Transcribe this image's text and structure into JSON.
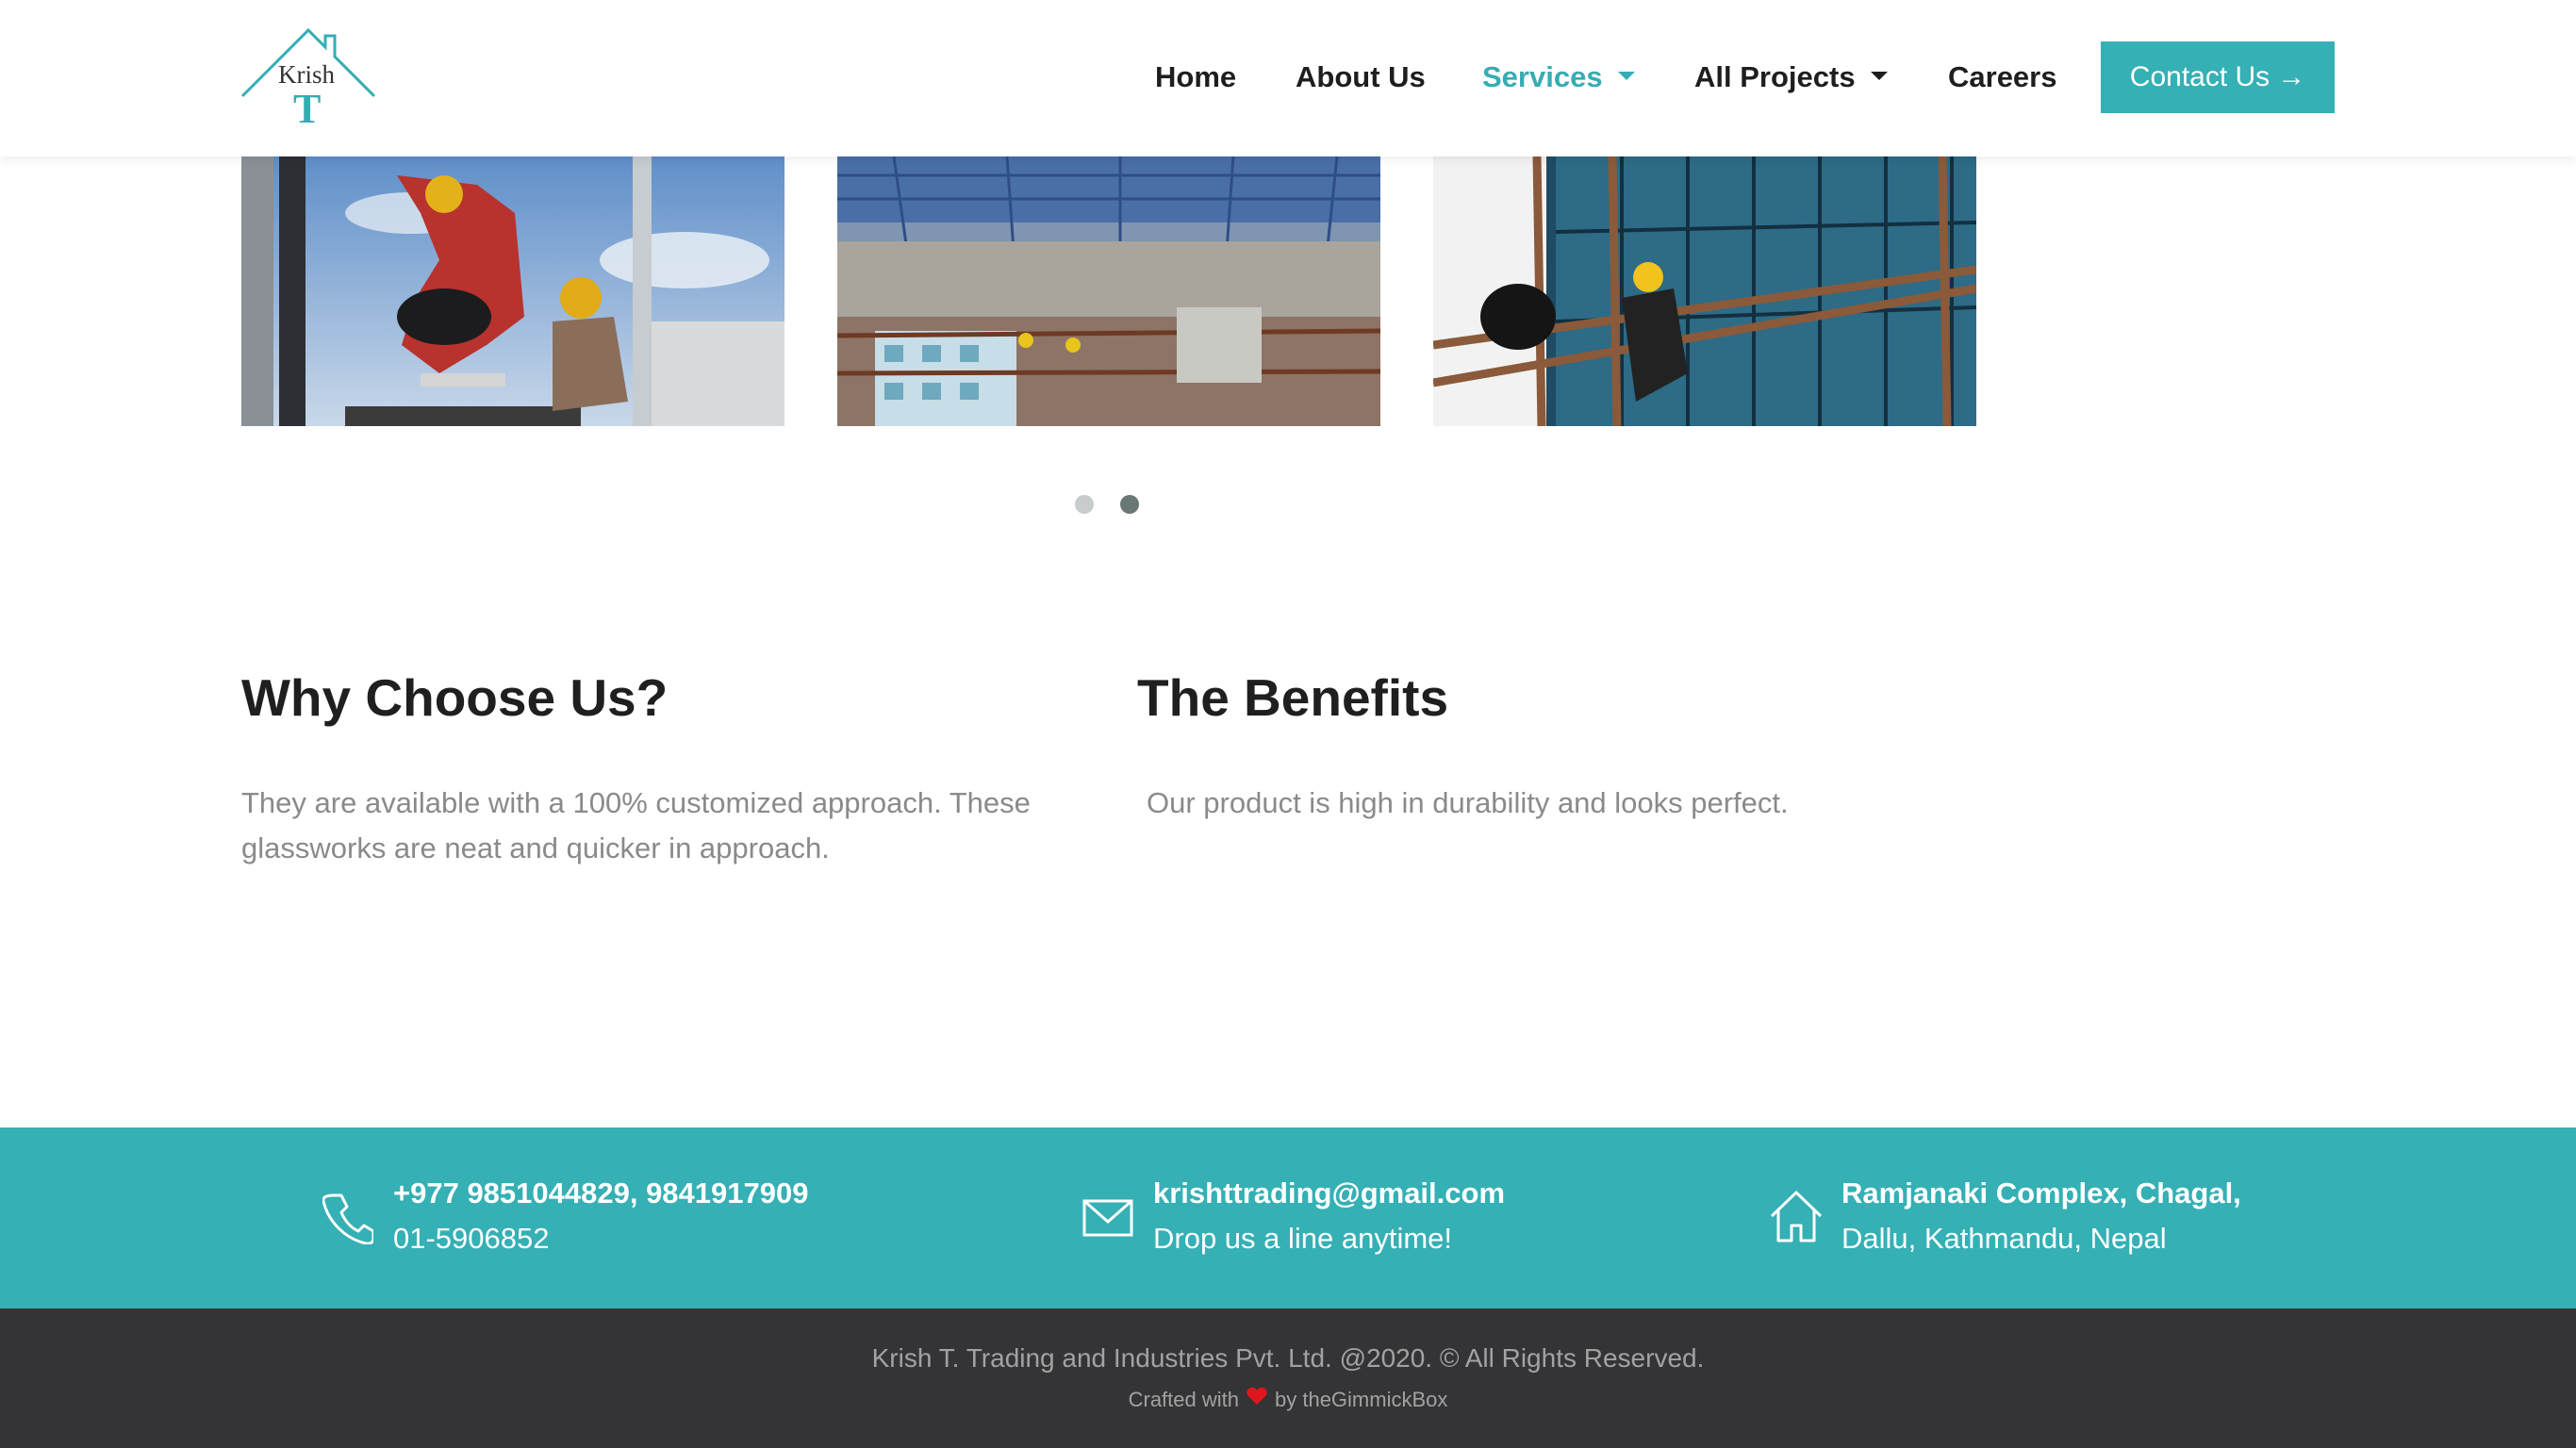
{
  "brand": {
    "logo_text_top": "Krish",
    "logo_text_bottom": "T",
    "accent_color": "#35b0b5"
  },
  "nav": {
    "items": [
      {
        "label": "Home",
        "dropdown": false,
        "active": false
      },
      {
        "label": "About Us",
        "dropdown": false,
        "active": false
      },
      {
        "label": "Services",
        "dropdown": true,
        "active": true
      },
      {
        "label": "All Projects",
        "dropdown": true,
        "active": false
      },
      {
        "label": "Careers",
        "dropdown": false,
        "active": false
      }
    ],
    "contact_button": {
      "label": "Contact Us",
      "icon": "arrow-right-icon"
    }
  },
  "carousel": {
    "slide_count": 2,
    "active_index": 1,
    "images": [
      "workers-installing-glass",
      "steel-roof-structure",
      "scaffolding-glass-facade"
    ]
  },
  "sections": {
    "why": {
      "title": "Why Choose Us?",
      "text": "They are available with a 100% customized approach. These glassworks are neat and quicker in approach."
    },
    "benefits": {
      "title": "The Benefits",
      "text": "Our product is high in durability and looks perfect."
    }
  },
  "contact_band": {
    "phone": {
      "icon": "phone-icon",
      "line1": "+977 9851044829, 9841917909",
      "line2": "01-5906852"
    },
    "email": {
      "icon": "mail-icon",
      "line1": "krishttrading@gmail.com",
      "line2": "Drop us a line anytime!"
    },
    "address": {
      "icon": "home-icon",
      "line1": "Ramjanaki Complex, Chagal,",
      "line2": "Dallu, Kathmandu, Nepal"
    }
  },
  "footer": {
    "copyright": "Krish T. Trading and Industries Pvt. Ltd. @2020. © All Rights Reserved.",
    "crafted_prefix": "Crafted with",
    "crafted_suffix": "by theGimmickBox"
  }
}
